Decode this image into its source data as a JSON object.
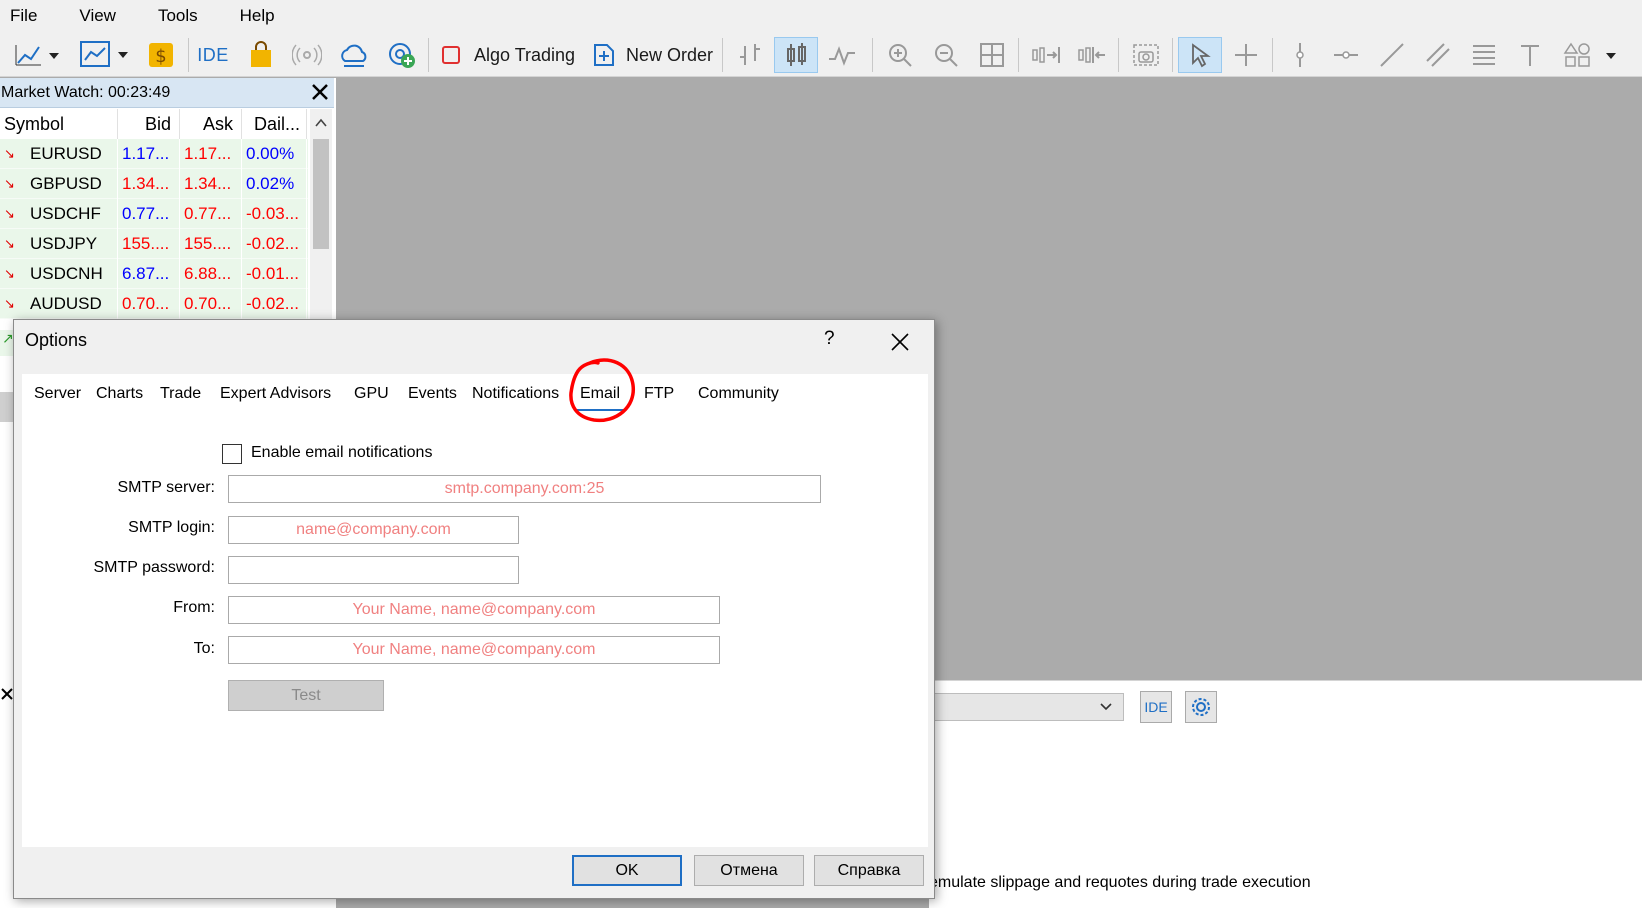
{
  "menu": [
    "File",
    "View",
    "Tools",
    "Help"
  ],
  "toolbar": {
    "ide_label": "IDE",
    "algo_trading_label": "Algo Trading",
    "new_order_label": "New Order"
  },
  "market_watch": {
    "title": "Market Watch: 00:23:49",
    "columns": [
      "Symbol",
      "Bid",
      "Ask",
      "Dail..."
    ],
    "rows": [
      {
        "symbol": "EURUSD",
        "bid": "1.17...",
        "ask": "1.17...",
        "daily": "0.00%",
        "bid_color": "blue",
        "ask_color": "red",
        "daily_color": "blue"
      },
      {
        "symbol": "GBPUSD",
        "bid": "1.34...",
        "ask": "1.34...",
        "daily": "0.02%",
        "bid_color": "red",
        "ask_color": "red",
        "daily_color": "blue"
      },
      {
        "symbol": "USDCHF",
        "bid": "0.77...",
        "ask": "0.77...",
        "daily": "-0.03...",
        "bid_color": "blue",
        "ask_color": "red",
        "daily_color": "red"
      },
      {
        "symbol": "USDJPY",
        "bid": "155....",
        "ask": "155....",
        "daily": "-0.02...",
        "bid_color": "red",
        "ask_color": "red",
        "daily_color": "red"
      },
      {
        "symbol": "USDCNH",
        "bid": "6.87...",
        "ask": "6.88...",
        "daily": "-0.01...",
        "bid_color": "blue",
        "ask_color": "red",
        "daily_color": "red"
      },
      {
        "symbol": "AUDUSD",
        "bid": "0.70...",
        "ask": "0.70...",
        "daily": "-0.02...",
        "bid_color": "red",
        "ask_color": "red",
        "daily_color": "red"
      }
    ]
  },
  "dialog": {
    "title": "Options",
    "help": "?",
    "tabs": [
      "Server",
      "Charts",
      "Trade",
      "Expert Advisors",
      "GPU",
      "Events",
      "Notifications",
      "Email",
      "FTP",
      "Community"
    ],
    "selected_tab": "Email",
    "enable_label": "Enable email notifications",
    "fields": {
      "smtp_server_label": "SMTP server:",
      "smtp_server_placeholder": "smtp.company.com:25",
      "smtp_login_label": "SMTP login:",
      "smtp_login_placeholder": "name@company.com",
      "smtp_password_label": "SMTP password:",
      "from_label": "From:",
      "from_placeholder": "Your Name, name@company.com",
      "to_label": "To:",
      "to_placeholder": "Your Name, name@company.com"
    },
    "test_label": "Test",
    "ok_label": "OK",
    "cancel_label": "Отмена",
    "help_label": "Справка"
  },
  "lower_panel": {
    "ide_label": "IDE",
    "hint_visible": "emulate slippage and requotes during trade execution"
  },
  "colors": {
    "accent": "#1f6fc5",
    "placeholder": "#f08080",
    "annotation_red": "#ff0000"
  }
}
